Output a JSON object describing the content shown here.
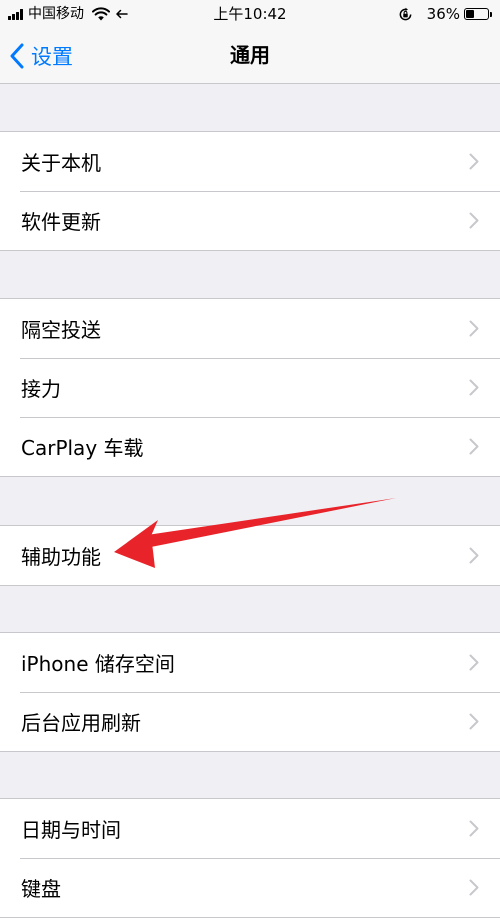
{
  "status_bar": {
    "carrier": "中国移动",
    "time": "上午10:42",
    "battery_percent": "36%",
    "battery_level": 0.36
  },
  "nav": {
    "back_label": "设置",
    "title": "通用"
  },
  "groups": [
    {
      "items": [
        {
          "label": "关于本机"
        },
        {
          "label": "软件更新"
        }
      ]
    },
    {
      "items": [
        {
          "label": "隔空投送"
        },
        {
          "label": "接力"
        },
        {
          "label": "CarPlay 车载"
        }
      ]
    },
    {
      "items": [
        {
          "label": "辅助功能"
        }
      ]
    },
    {
      "items": [
        {
          "label": "iPhone 储存空间"
        },
        {
          "label": "后台应用刷新"
        }
      ]
    },
    {
      "items": [
        {
          "label": "日期与时间"
        },
        {
          "label": "键盘"
        }
      ]
    }
  ],
  "colors": {
    "accent": "#007aff",
    "background": "#efeff4",
    "separator": "#c8c7cc",
    "annotation": "#e8242a"
  },
  "icons": {
    "back": "chevron-left-icon",
    "row_disclosure": "chevron-right-icon",
    "wifi": "wifi-icon",
    "location": "location-arrow-icon",
    "rotation_lock": "rotation-lock-icon",
    "battery": "battery-icon"
  }
}
